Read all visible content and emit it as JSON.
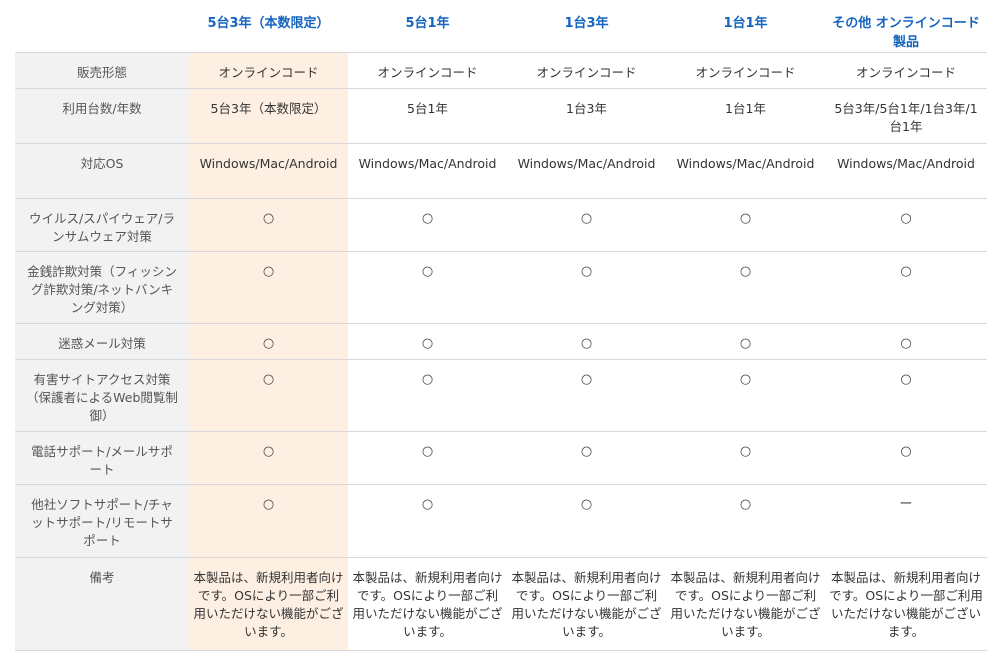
{
  "colors": {
    "header_text": "#1565c0",
    "label_bg": "#f2f2f2",
    "highlight_bg": "#fdf0e3",
    "border": "#d9d9d9"
  },
  "products": [
    "5台3年（本数限定）",
    "5台1年",
    "1台3年",
    "1台1年",
    "その他 オンラインコード製品"
  ],
  "rows": [
    {
      "label": "販売形態",
      "cells": [
        "オンラインコード",
        "オンラインコード",
        "オンラインコード",
        "オンラインコード",
        "オンラインコード"
      ]
    },
    {
      "label": "利用台数/年数",
      "cells": [
        "5台3年（本数限定）",
        "5台1年",
        "1台3年",
        "1台1年",
        "5台3年/5台1年/1台3年/1台1年"
      ]
    },
    {
      "label": "対応OS",
      "cells": [
        "Windows/Mac/Android",
        "Windows/Mac/Android",
        "Windows/Mac/Android",
        "Windows/Mac/Android",
        "Windows/Mac/Android"
      ]
    },
    {
      "label": "ウイルス/スパイウェア/ランサムウェア対策",
      "cells": [
        "○",
        "○",
        "○",
        "○",
        "○"
      ]
    },
    {
      "label": "金銭詐欺対策（フィッシング詐欺対策/ネットバンキング対策）",
      "cells": [
        "○",
        "○",
        "○",
        "○",
        "○"
      ]
    },
    {
      "label": "迷惑メール対策",
      "cells": [
        "○",
        "○",
        "○",
        "○",
        "○"
      ]
    },
    {
      "label": "有害サイトアクセス対策（保護者によるWeb閲覧制御）",
      "cells": [
        "○",
        "○",
        "○",
        "○",
        "○"
      ]
    },
    {
      "label": "電話サポート/メールサポート",
      "cells": [
        "○",
        "○",
        "○",
        "○",
        "○"
      ]
    },
    {
      "label": "他社ソフトサポート/チャットサポート/リモートサポート",
      "cells": [
        "○",
        "○",
        "○",
        "○",
        "ー"
      ]
    },
    {
      "label": "備考",
      "cells": [
        "本製品は、新規利用者向けです。OSにより一部ご利用いただけない機能がございます。",
        "本製品は、新規利用者向けです。OSにより一部ご利用いただけない機能がございます。",
        "本製品は、新規利用者向けです。OSにより一部ご利用いただけない機能がございます。",
        "本製品は、新規利用者向けです。OSにより一部ご利用いただけない機能がございます。",
        "本製品は、新規利用者向けです。OSにより一部ご利用いただけない機能がございます。"
      ]
    }
  ]
}
